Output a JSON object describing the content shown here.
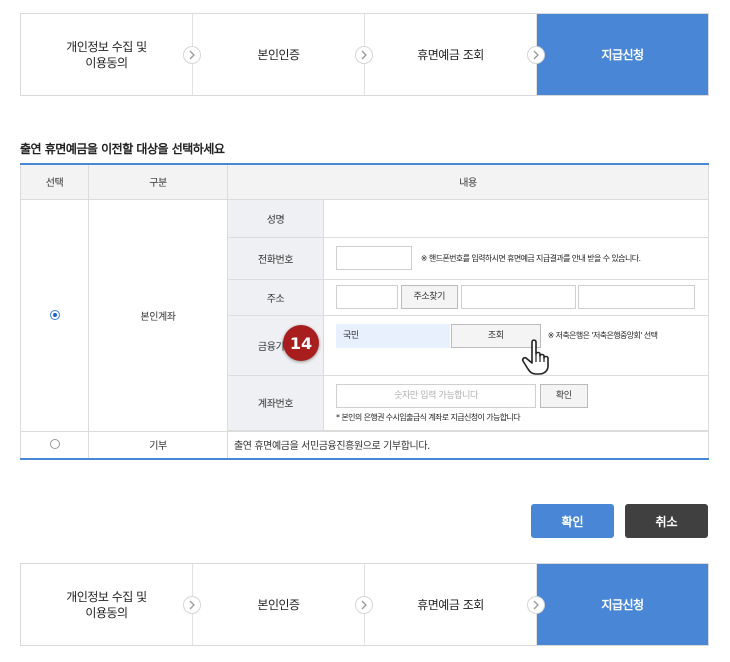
{
  "steps": [
    "개인정보 수집 및\n이용동의",
    "본인인증",
    "휴면예금 조회",
    "지급신청"
  ],
  "section_title": "출연 휴면예금을 이전할 대상을 선택하세요",
  "table": {
    "headers": {
      "select": "선택",
      "category": "구분",
      "content": "내용"
    },
    "row_own": {
      "category": "본인계좌",
      "fields": {
        "name_label": "성명",
        "phone_label": "전화번호",
        "phone_note": "※ 핸드폰번호를 입력하시면 휴면예금 지급결과를 안내 받을 수 있습니다.",
        "address_label": "주소",
        "address_button": "주소찾기",
        "bank_label": "금융기관",
        "bank_value": "국민",
        "bank_search_button": "조회",
        "bank_note": "※ 저축은행은 '저축은행중앙회' 선택",
        "account_label": "계좌번호",
        "account_placeholder": "숫자만 입력 가능합니다",
        "account_confirm_button": "확인",
        "account_note": "* 본인의 은행권 수시입출금식 계좌로 지급신청이 가능합니다"
      }
    },
    "row_donate": {
      "category": "기부",
      "content": "출연 휴면예금을 서민금융진흥원으로 기부합니다."
    }
  },
  "badge": "14",
  "buttons": {
    "confirm": "확인",
    "cancel": "취소"
  },
  "colors": {
    "accent": "#4a86d6",
    "cancel": "#404040",
    "badge": "#a81e1e"
  }
}
